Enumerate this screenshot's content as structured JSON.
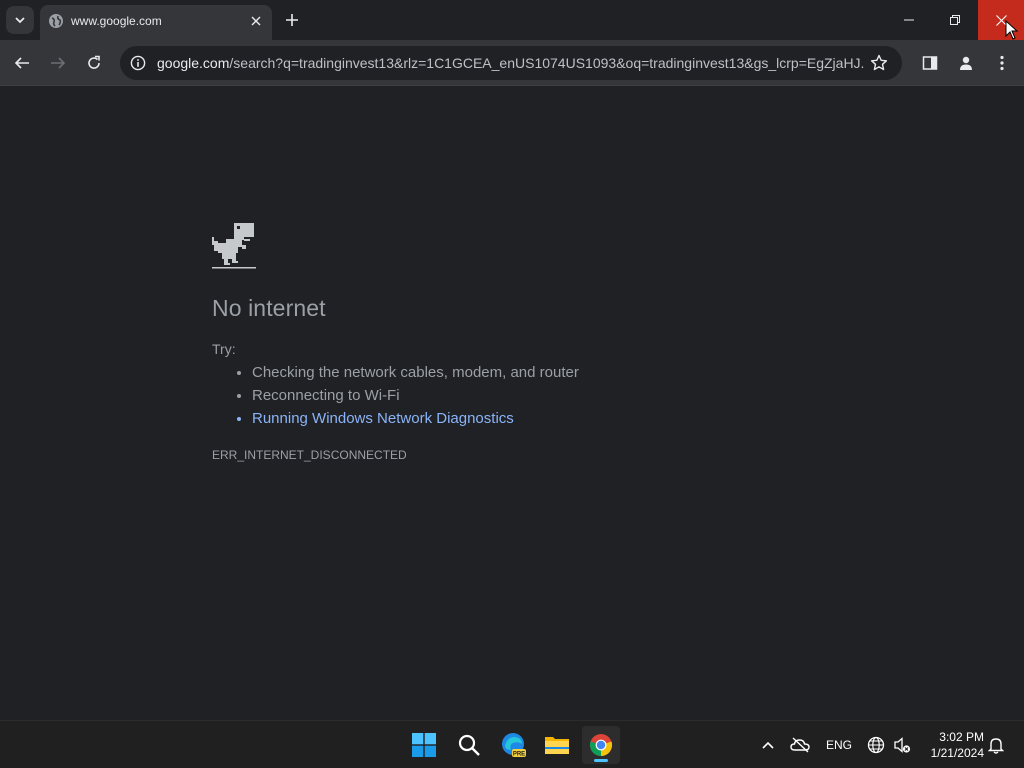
{
  "browser": {
    "tab": {
      "title": "www.google.com",
      "icon": "globe-icon"
    },
    "omnibox": {
      "url_host": "google.com",
      "url_rest": "/search?q=tradinginvest13&rlz=1C1GCEA_enUS1074US1093&oq=tradinginvest13&gs_lcrp=EgZjaHJ..."
    }
  },
  "error_page": {
    "heading": "No internet",
    "try_label": "Try:",
    "suggestions": [
      "Checking the network cables, modem, and router",
      "Reconnecting to Wi-Fi",
      "Running Windows Network Diagnostics"
    ],
    "error_code": "ERR_INTERNET_DISCONNECTED"
  },
  "taskbar": {
    "language": "ENG",
    "time": "3:02 PM",
    "date": "1/21/2024"
  },
  "colors": {
    "page_bg": "#202124",
    "link": "#8ab4f8",
    "close_hover": "#c42b1c",
    "active_indicator": "#4cc2ff"
  }
}
